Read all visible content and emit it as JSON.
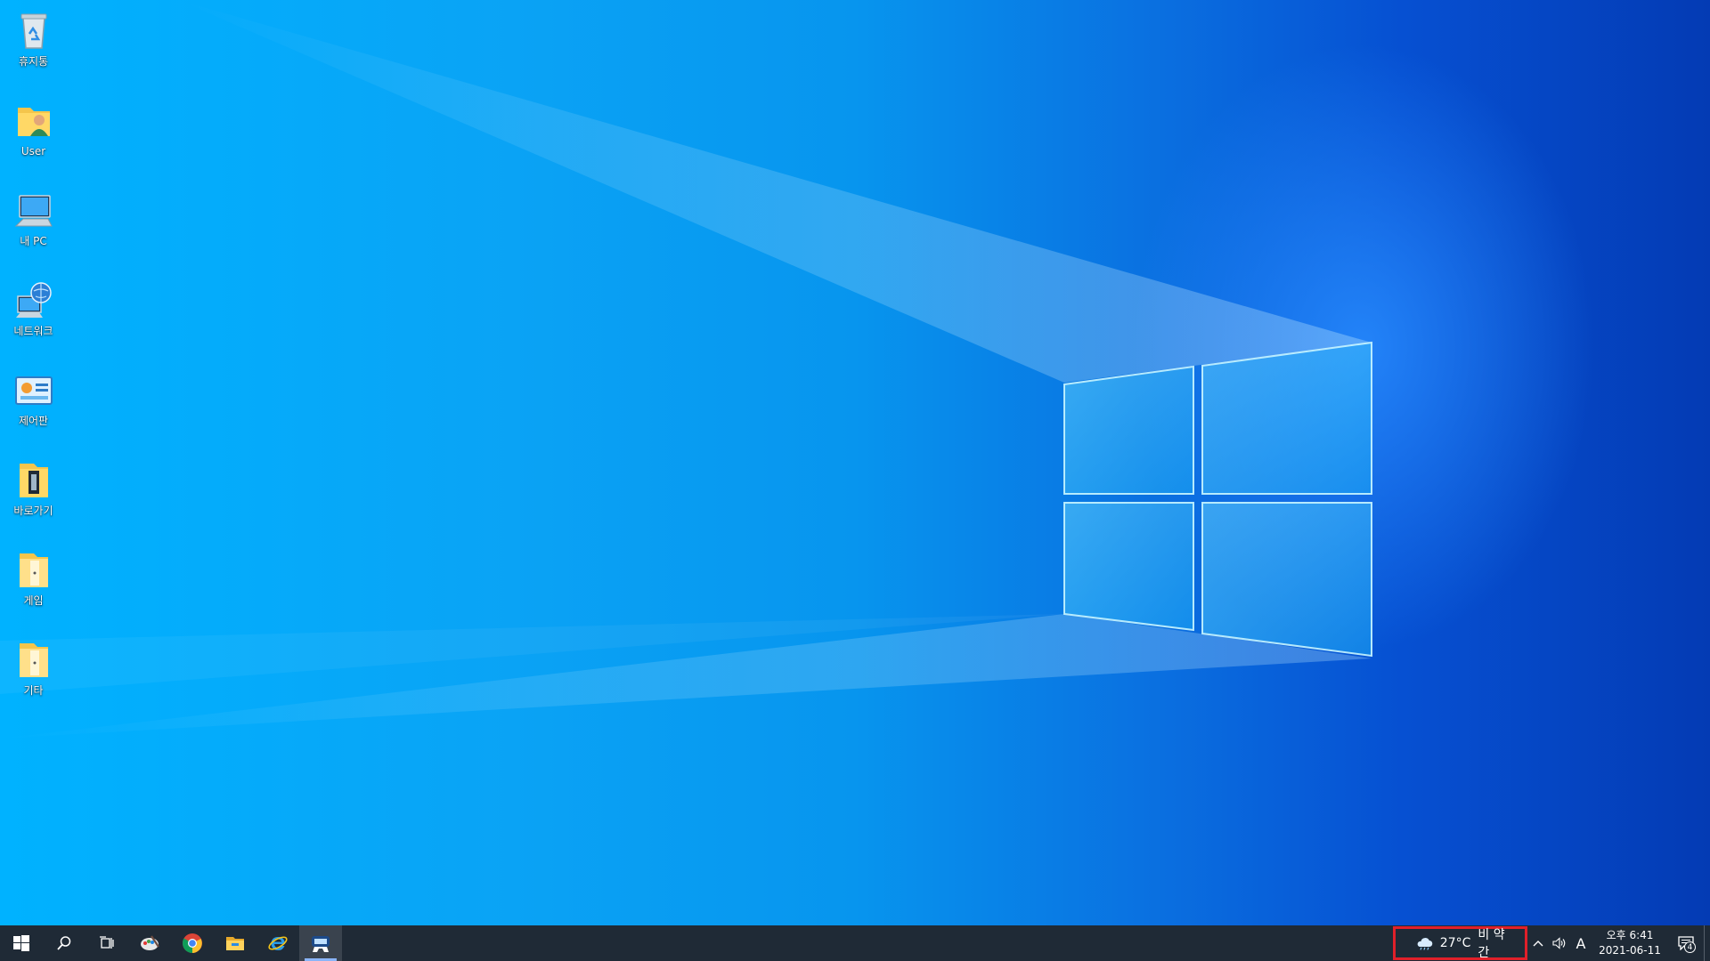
{
  "desktop": {
    "icons": [
      {
        "label": "휴지통",
        "icon": "recycle-bin-icon"
      },
      {
        "label": "User",
        "icon": "user-folder-icon"
      },
      {
        "label": "내 PC",
        "icon": "this-pc-icon"
      },
      {
        "label": "네트워크",
        "icon": "network-icon"
      },
      {
        "label": "제어판",
        "icon": "control-panel-icon"
      },
      {
        "label": "바로가기",
        "icon": "shortcut-folder-icon"
      },
      {
        "label": "게임",
        "icon": "folder-icon"
      },
      {
        "label": "기타",
        "icon": "folder-icon"
      }
    ]
  },
  "taskbar": {
    "pinned": [
      {
        "name": "start-button",
        "icon": "windows-logo-icon"
      },
      {
        "name": "search-button",
        "icon": "search-icon"
      },
      {
        "name": "task-view-button",
        "icon": "task-view-icon"
      },
      {
        "name": "paint-app-button",
        "icon": "paint-icon"
      },
      {
        "name": "chrome-button",
        "icon": "chrome-icon"
      },
      {
        "name": "file-explorer-button",
        "icon": "folder-icon"
      },
      {
        "name": "internet-explorer-button",
        "icon": "ie-icon"
      },
      {
        "name": "game-app-button",
        "icon": "game-controller-icon",
        "active": true
      }
    ],
    "weather": {
      "temperature": "27°C",
      "condition": "비 약간",
      "icon": "cloud-rain-icon"
    },
    "tray": {
      "chevron_icon": "chevron-up-icon",
      "volume_icon": "speaker-icon",
      "ime_label": "A"
    },
    "clock": {
      "time": "오후 6:41",
      "date": "2021-06-11"
    },
    "notifications": {
      "count": "4",
      "icon": "action-center-icon"
    }
  },
  "colors": {
    "taskbar_bg": "#1f2a36",
    "highlight_border": "#e0202a",
    "wallpaper_light": "#00b2ff",
    "wallpaper_dark": "#043bb4"
  }
}
